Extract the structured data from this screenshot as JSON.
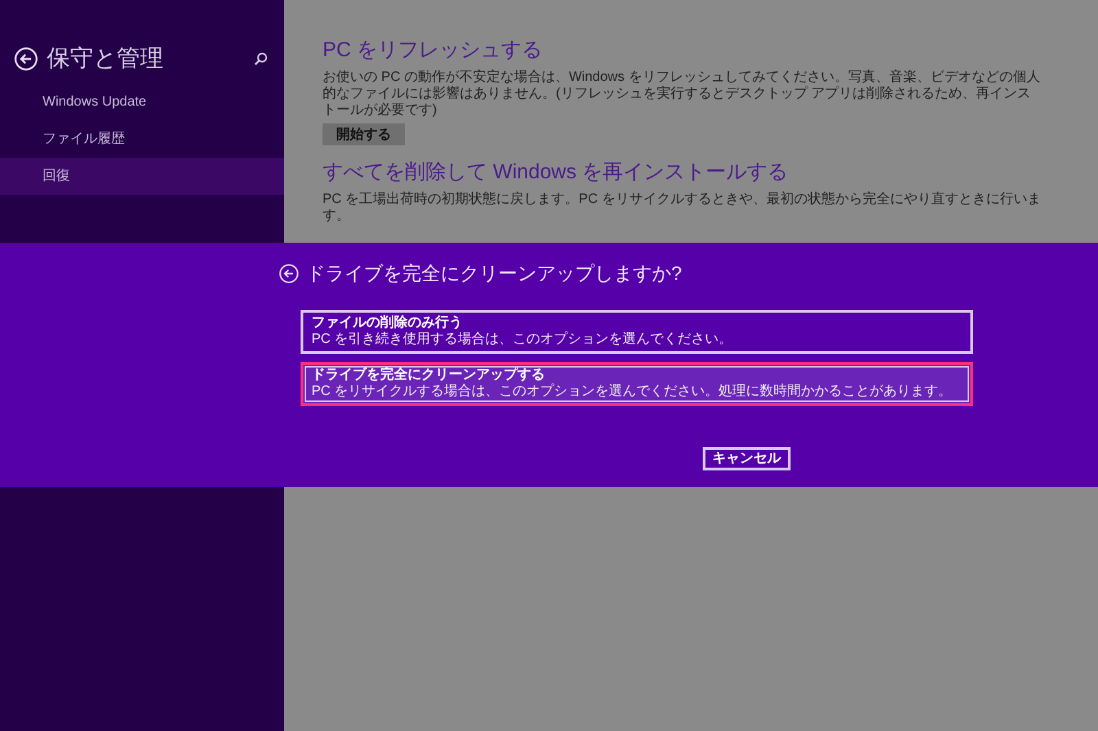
{
  "sidebar": {
    "title": "保守と管理",
    "items": [
      {
        "label": "Windows Update",
        "selected": false
      },
      {
        "label": "ファイル履歴",
        "selected": false
      },
      {
        "label": "回復",
        "selected": true
      }
    ]
  },
  "sections": [
    {
      "heading": "PC をリフレッシュする",
      "description": "お使いの PC の動作が不安定な場合は、Windows をリフレッシュしてみてください。写真、音楽、ビデオなどの個人的なファイルには影響はありません。(リフレッシュを実行するとデスクトップ アプリは削除されるため、再インストールが必要です)",
      "button": "開始する"
    },
    {
      "heading": "すべてを削除して Windows を再インストールする",
      "description": "PC を工場出荷時の初期状態に戻します。PC をリサイクルするときや、最初の状態から完全にやり直すときに行います。"
    }
  ],
  "dialog": {
    "title": "ドライブを完全にクリーンアップしますか?",
    "options": [
      {
        "title": "ファイルの削除のみ行う",
        "description": "PC を引き続き使用する場合は、このオプションを選んでください。",
        "selected": false
      },
      {
        "title": "ドライブを完全にクリーンアップする",
        "description": "PC をリサイクルする場合は、このオプションを選んでください。処理に数時間かかることがあります。",
        "selected": true
      }
    ],
    "cancel": "キャンセル"
  }
}
